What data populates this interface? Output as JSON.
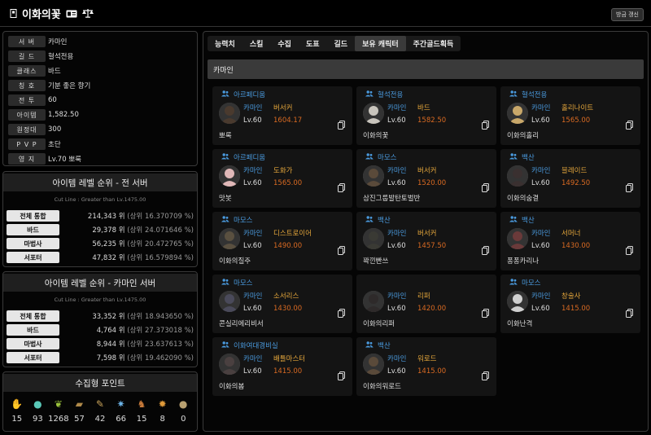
{
  "header": {
    "name": "이화의꽃",
    "refresh_label": "방금 갱신"
  },
  "info": [
    {
      "label": "서 버",
      "value": "카마인"
    },
    {
      "label": "길 드",
      "value": "혈석전용"
    },
    {
      "label": "클래스",
      "value": "바드"
    },
    {
      "label": "칭 호",
      "value": "기분 좋은 향기"
    },
    {
      "label": "전 투",
      "value": "60"
    },
    {
      "label": "아이템",
      "value": "1,582.50"
    },
    {
      "label": "원정대",
      "value": "300"
    },
    {
      "label": "P V P",
      "value": "초단"
    },
    {
      "label": "영 지",
      "value": "Lv.70 뽀룩"
    }
  ],
  "rank_all": {
    "title": "아이템 레벨 순위 - 전 서버",
    "cutline": "Cut Line : Greater than Lv.1475.00",
    "rows": [
      {
        "label": "전체 통합",
        "rank": "214,343 위",
        "pct": "(상위 16.370709 %)"
      },
      {
        "label": "바드",
        "rank": "29,378 위",
        "pct": "(상위 24.071646 %)"
      },
      {
        "label": "마법사",
        "rank": "56,235 위",
        "pct": "(상위 20.472765 %)"
      },
      {
        "label": "서포터",
        "rank": "47,832 위",
        "pct": "(상위 16.579894 %)"
      }
    ]
  },
  "rank_server": {
    "title": "아이템 레벨 순위 - 카마인 서버",
    "cutline": "Cut Line : Greater than Lv.1475.00",
    "rows": [
      {
        "label": "전체 통합",
        "rank": "33,352 위",
        "pct": "(상위 18.943650 %)"
      },
      {
        "label": "바드",
        "rank": "4,764 위",
        "pct": "(상위 27.373018 %)"
      },
      {
        "label": "마법사",
        "rank": "8,944 위",
        "pct": "(상위 23.637613 %)"
      },
      {
        "label": "서포터",
        "rank": "7,598 위",
        "pct": "(상위 19.462090 %)"
      }
    ]
  },
  "collect": {
    "title": "수집형 포인트",
    "items": [
      {
        "icon": "mokoko-seed-icon",
        "glyph": "✋",
        "color": "#cccccc",
        "value": "15"
      },
      {
        "icon": "island-heart-icon",
        "glyph": "●",
        "color": "#5ac8b8",
        "value": "93"
      },
      {
        "icon": "mokoko-seed-sprout-icon",
        "glyph": "❦",
        "color": "#9bc43c",
        "value": "1268"
      },
      {
        "icon": "great-art-icon",
        "glyph": "▰",
        "color": "#b08a4a",
        "value": "57"
      },
      {
        "icon": "adventure-tome-icon",
        "glyph": "✎",
        "color": "#c9a35a",
        "value": "42"
      },
      {
        "icon": "world-tree-leaf-icon",
        "glyph": "✷",
        "color": "#6cb4e8",
        "value": "66"
      },
      {
        "icon": "giants-heart-icon",
        "glyph": "♞",
        "color": "#c87a3a",
        "value": "15"
      },
      {
        "icon": "ignea-token-icon",
        "glyph": "✹",
        "color": "#e09a3a",
        "value": "8"
      },
      {
        "icon": "orpheus-star-icon",
        "glyph": "●",
        "color": "#b8a070",
        "value": "0"
      }
    ]
  },
  "tabs": [
    {
      "label": "능력치",
      "active": false
    },
    {
      "label": "스킬",
      "active": false
    },
    {
      "label": "수집",
      "active": false
    },
    {
      "label": "도표",
      "active": false
    },
    {
      "label": "길드",
      "active": false
    },
    {
      "label": "보유 캐릭터",
      "active": true
    },
    {
      "label": "주간골드획득",
      "active": false
    }
  ],
  "server_group": "카마인",
  "characters": [
    {
      "guild": "아르페디움",
      "server": "카마인",
      "class": "버서커",
      "lv": "Lv.60",
      "ilvl": "1604.17",
      "name": "뽀록",
      "avatar": "#4a3a2e"
    },
    {
      "guild": "혈석전용",
      "server": "카마인",
      "class": "바드",
      "lv": "Lv.60",
      "ilvl": "1582.50",
      "name": "이화의꽃",
      "avatar": "#c8c4bc"
    },
    {
      "guild": "혈석전용",
      "server": "카마인",
      "class": "홀리나이트",
      "lv": "Lv.60",
      "ilvl": "1565.00",
      "name": "이화의홀리",
      "avatar": "#c9a86a"
    },
    {
      "guild": "아르페디움",
      "server": "카마인",
      "class": "도화가",
      "lv": "Lv.60",
      "ilvl": "1565.00",
      "name": "맛봇",
      "avatar": "#e0b8b8"
    },
    {
      "guild": "마모스",
      "server": "카마인",
      "class": "버서커",
      "lv": "Lv.60",
      "ilvl": "1520.00",
      "name": "삼진그룹발탄토벌반",
      "avatar": "#5a4a3a"
    },
    {
      "guild": "백산",
      "server": "카마인",
      "class": "블레이드",
      "lv": "Lv.60",
      "ilvl": "1492.50",
      "name": "이화의숨결",
      "avatar": "#3a3030"
    },
    {
      "guild": "마모스",
      "server": "카마인",
      "class": "디스트로이어",
      "lv": "Lv.60",
      "ilvl": "1490.00",
      "name": "이화의질주",
      "avatar": "#5a5040"
    },
    {
      "guild": "백산",
      "server": "카마인",
      "class": "버서커",
      "lv": "Lv.60",
      "ilvl": "1457.50",
      "name": "꽉낀빤쓰",
      "avatar": "#3a3a34"
    },
    {
      "guild": "백산",
      "server": "카마인",
      "class": "서머너",
      "lv": "Lv.60",
      "ilvl": "1430.00",
      "name": "퐁퐁카리나",
      "avatar": "#6a3a3a"
    },
    {
      "guild": "마모스",
      "server": "카마인",
      "class": "소서리스",
      "lv": "Lv.60",
      "ilvl": "1430.00",
      "name": "콘실리에리비서",
      "avatar": "#4a4a5a"
    },
    {
      "guild": "",
      "server": "카마인",
      "class": "리퍼",
      "lv": "Lv.60",
      "ilvl": "1420.00",
      "name": "이화의리퍼",
      "avatar": "#2e2a2a"
    },
    {
      "guild": "마모스",
      "server": "카마인",
      "class": "창술사",
      "lv": "Lv.60",
      "ilvl": "1415.00",
      "name": "이화난격",
      "avatar": "#d0d0d0"
    },
    {
      "guild": "이화여대경비실",
      "server": "카마인",
      "class": "배틀마스터",
      "lv": "Lv.60",
      "ilvl": "1415.00",
      "name": "이화의봄",
      "avatar": "#4a4040"
    },
    {
      "guild": "백산",
      "server": "카마인",
      "class": "워로드",
      "lv": "Lv.60",
      "ilvl": "1415.00",
      "name": "이화의워로드",
      "avatar": "#5a4a3a"
    }
  ]
}
